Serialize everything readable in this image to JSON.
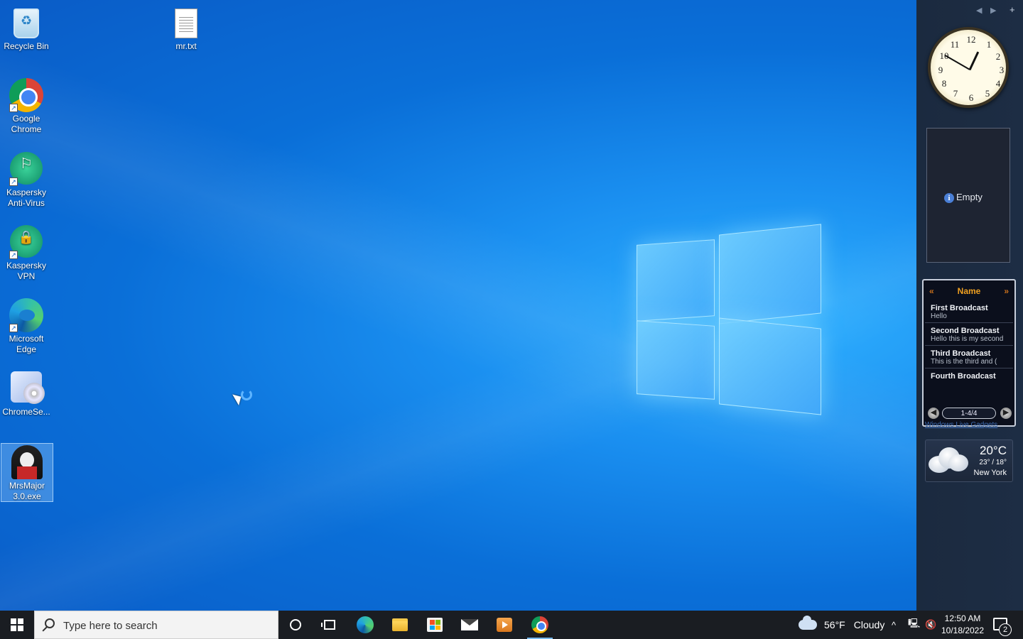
{
  "desktop": {
    "icons": [
      {
        "label": "Recycle Bin",
        "icon": "recycle-bin-icon"
      },
      {
        "label": "mr.txt",
        "icon": "text-file-icon"
      },
      {
        "label": "Google Chrome",
        "icon": "chrome-icon"
      },
      {
        "label": "Kaspersky Anti-Virus",
        "icon": "kaspersky-antivirus-icon"
      },
      {
        "label": "Kaspersky VPN",
        "icon": "kaspersky-vpn-icon"
      },
      {
        "label": "Microsoft Edge",
        "icon": "edge-icon"
      },
      {
        "label": "ChromeSe...",
        "icon": "setup-disc-icon"
      },
      {
        "label": "MrsMajor 3.0.exe",
        "icon": "mrsmajor-executable-icon",
        "selected": true
      }
    ]
  },
  "gadgets": {
    "clock": {
      "hour": 12,
      "minute": 50,
      "numerals": [
        "12",
        "1",
        "2",
        "3",
        "4",
        "5",
        "6",
        "7",
        "8",
        "9",
        "10",
        "11"
      ]
    },
    "slideshow": {
      "status": "Empty",
      "info_glyph": "i"
    },
    "feed": {
      "header": "Name",
      "prev_glyph": "«",
      "next_glyph": "»",
      "items": [
        {
          "title": "First Broadcast",
          "snippet": "Hello"
        },
        {
          "title": "Second Broadcast",
          "snippet": "Hello this is my second"
        },
        {
          "title": "Third Broadcast",
          "snippet": "This is the third and ("
        },
        {
          "title": "Fourth Broadcast",
          "snippet": ""
        }
      ],
      "page_indicator": "1-4/4",
      "footer_link": "Windows Live Gadgets"
    },
    "weather": {
      "temp": "20°C",
      "range": "23° / 18°",
      "city": "New York"
    }
  },
  "taskbar": {
    "search_placeholder": "Type here to search",
    "apps": [
      "cortana-icon",
      "task-view-icon",
      "edge-icon",
      "file-explorer-icon",
      "store-icon",
      "mail-icon",
      "media-player-icon",
      "chrome-icon"
    ],
    "weather": {
      "temp": "56°F",
      "condition": "Cloudy"
    },
    "time": "12:50 AM",
    "date": "10/18/2022",
    "notification_count": "2"
  },
  "colors": {
    "taskbar": "#1a1d22",
    "sidebar": "#1b2a3f",
    "feed_header": "#f0a020"
  }
}
